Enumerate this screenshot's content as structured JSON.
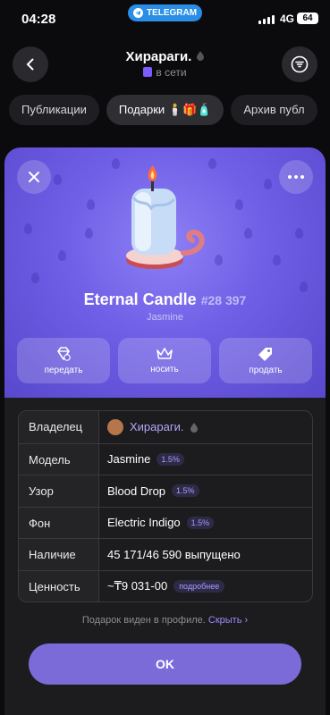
{
  "status_bar": {
    "time": "04:28",
    "app_pill": "TELEGRAM",
    "network": "4G",
    "battery": "64"
  },
  "header": {
    "title": "Хирараги.",
    "status": "в сети"
  },
  "tabs": [
    {
      "label": "Публикации"
    },
    {
      "label": "Подарки"
    },
    {
      "label": "Архив публ"
    }
  ],
  "gift": {
    "name": "Eternal Candle",
    "number": "#28 397",
    "model_name": "Jasmine",
    "actions": [
      {
        "label": "передать",
        "icon": "transfer-icon"
      },
      {
        "label": "носить",
        "icon": "crown-icon"
      },
      {
        "label": "продать",
        "icon": "tag-icon"
      }
    ]
  },
  "details": [
    {
      "key": "Владелец",
      "value": "Хирараги."
    },
    {
      "key": "Модель",
      "value": "Jasmine",
      "pct": "1.5%"
    },
    {
      "key": "Узор",
      "value": "Blood Drop",
      "pct": "1.5%"
    },
    {
      "key": "Фон",
      "value": "Electric Indigo",
      "pct": "1.5%"
    },
    {
      "key": "Наличие",
      "value": "45 171/46 590 выпущено"
    },
    {
      "key": "Ценность",
      "value": "~₸9 031-00",
      "pill": "подробнее"
    }
  ],
  "footer": {
    "text": "Подарок виден в профиле.",
    "link": "Скрыть ›"
  },
  "ok_label": "OK",
  "colors": {
    "accent": "#7b6bd9",
    "hero": "#6f5ee6",
    "link": "#9b8cff",
    "telegram": "#2a8ee6"
  }
}
